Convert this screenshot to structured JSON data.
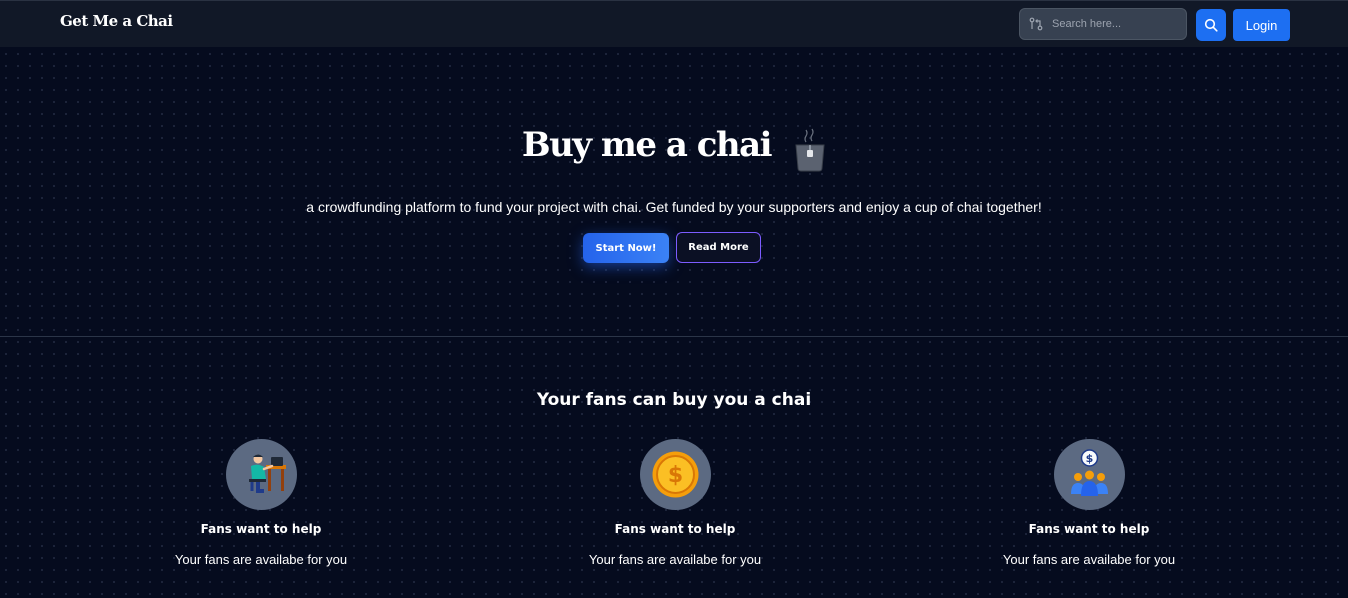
{
  "navbar": {
    "brand": "Get Me a Chai",
    "search_placeholder": "Search here...",
    "login_label": "Login"
  },
  "hero": {
    "title": "Buy me a chai",
    "subtitle": "a crowdfunding platform to fund your project with chai. Get funded by your supporters and enjoy a cup of chai together!",
    "start_label": "Start Now!",
    "read_more_label": "Read More"
  },
  "fans_section": {
    "title": "Your fans can buy you a chai",
    "features": [
      {
        "icon": "person-at-desk-icon",
        "title": "Fans want to help",
        "description": "Your fans are availabe for you"
      },
      {
        "icon": "gold-coin-icon",
        "title": "Fans want to help",
        "description": "Your fans are availabe for you"
      },
      {
        "icon": "group-donation-icon",
        "title": "Fans want to help",
        "description": "Your fans are availabe for you"
      }
    ]
  },
  "colors": {
    "background": "#050b1e",
    "navbar": "#111827",
    "primary_button": "#1d6ff2",
    "read_more_border": "#7c5cff",
    "icon_circle": "#5c6a82"
  }
}
